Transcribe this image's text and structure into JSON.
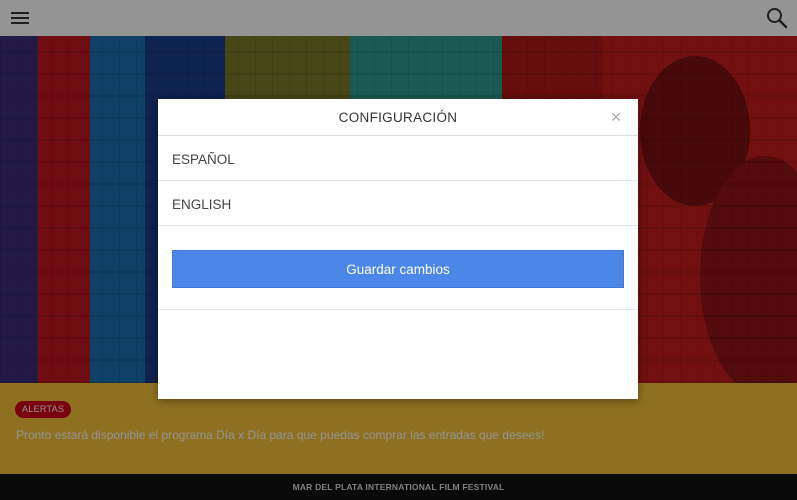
{
  "topbar": {
    "menu_icon": "hamburger-menu-icon",
    "search_icon": "search-icon"
  },
  "hero": {
    "stripe_colors": [
      "#3b2c7a",
      "#c01722",
      "#1a6fb0",
      "#1b3d8a",
      "#7a7a2a",
      "#2e9c8c",
      "#b01818",
      "#c41d1d"
    ]
  },
  "alert": {
    "badge": "ALERTAS",
    "message": "Pronto estará disponible el programa Día x Día para que puedas comprar las entradas que desees!",
    "color": "#f5c237",
    "badge_color": "#d0021b"
  },
  "footer": {
    "text": "MAR DEL PLATA INTERNATIONAL FILM FESTIVAL"
  },
  "modal": {
    "title": "CONFIGURACIÓN",
    "close_icon": "close-icon",
    "close_glyph": "×",
    "languages": [
      {
        "label": "ESPAÑOL"
      },
      {
        "label": "ENGLISH"
      }
    ],
    "save_label": "Guardar cambios",
    "accent": "#4a87e8"
  }
}
